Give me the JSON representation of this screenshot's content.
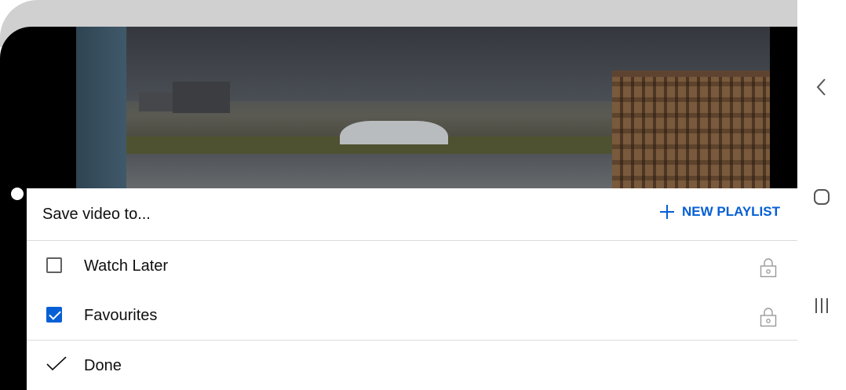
{
  "sheet": {
    "title": "Save video to...",
    "new_playlist_label": "NEW PLAYLIST",
    "playlists": [
      {
        "label": "Watch Later",
        "checked": false,
        "icon": "lock-icon"
      },
      {
        "label": "Favourites",
        "checked": true,
        "icon": "lock-icon"
      }
    ],
    "done_label": "Done"
  },
  "navbar": {
    "back_icon": "back-icon",
    "home_icon": "home-icon",
    "recents_icon": "recents-icon"
  },
  "colors": {
    "accent": "#065fd4",
    "text": "#0f0f0f",
    "divider": "#dcdcdc"
  }
}
